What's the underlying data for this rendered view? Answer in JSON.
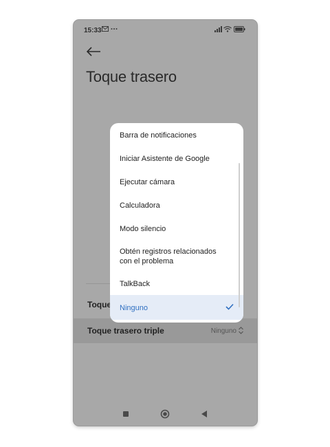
{
  "status_bar": {
    "time": "15:33",
    "left_icons": [
      "mail-icon",
      "more-dots-icon"
    ],
    "right_icons": [
      "signal-icon",
      "wifi-icon",
      "battery-icon"
    ]
  },
  "header": {
    "back_icon": "back-arrow-icon",
    "title": "Toque trasero"
  },
  "settings": {
    "double_tap_label": "Toque",
    "triple_tap_label": "Toque trasero triple",
    "triple_tap_value": "Ninguno"
  },
  "dropdown": {
    "options": [
      {
        "label": "Barra de notificaciones"
      },
      {
        "label": "Iniciar Asistente de Google"
      },
      {
        "label": "Ejecutar cámara"
      },
      {
        "label": "Calculadora"
      },
      {
        "label": "Modo silencio"
      },
      {
        "label": "Obtén registros relacionados con el problema"
      },
      {
        "label": "TalkBack"
      },
      {
        "label": "Ninguno",
        "selected": true
      }
    ],
    "selected_color": "#2f6fc1"
  },
  "nav_bar": {
    "icons": [
      "recents-square-icon",
      "home-circle-icon",
      "back-triangle-icon"
    ]
  }
}
